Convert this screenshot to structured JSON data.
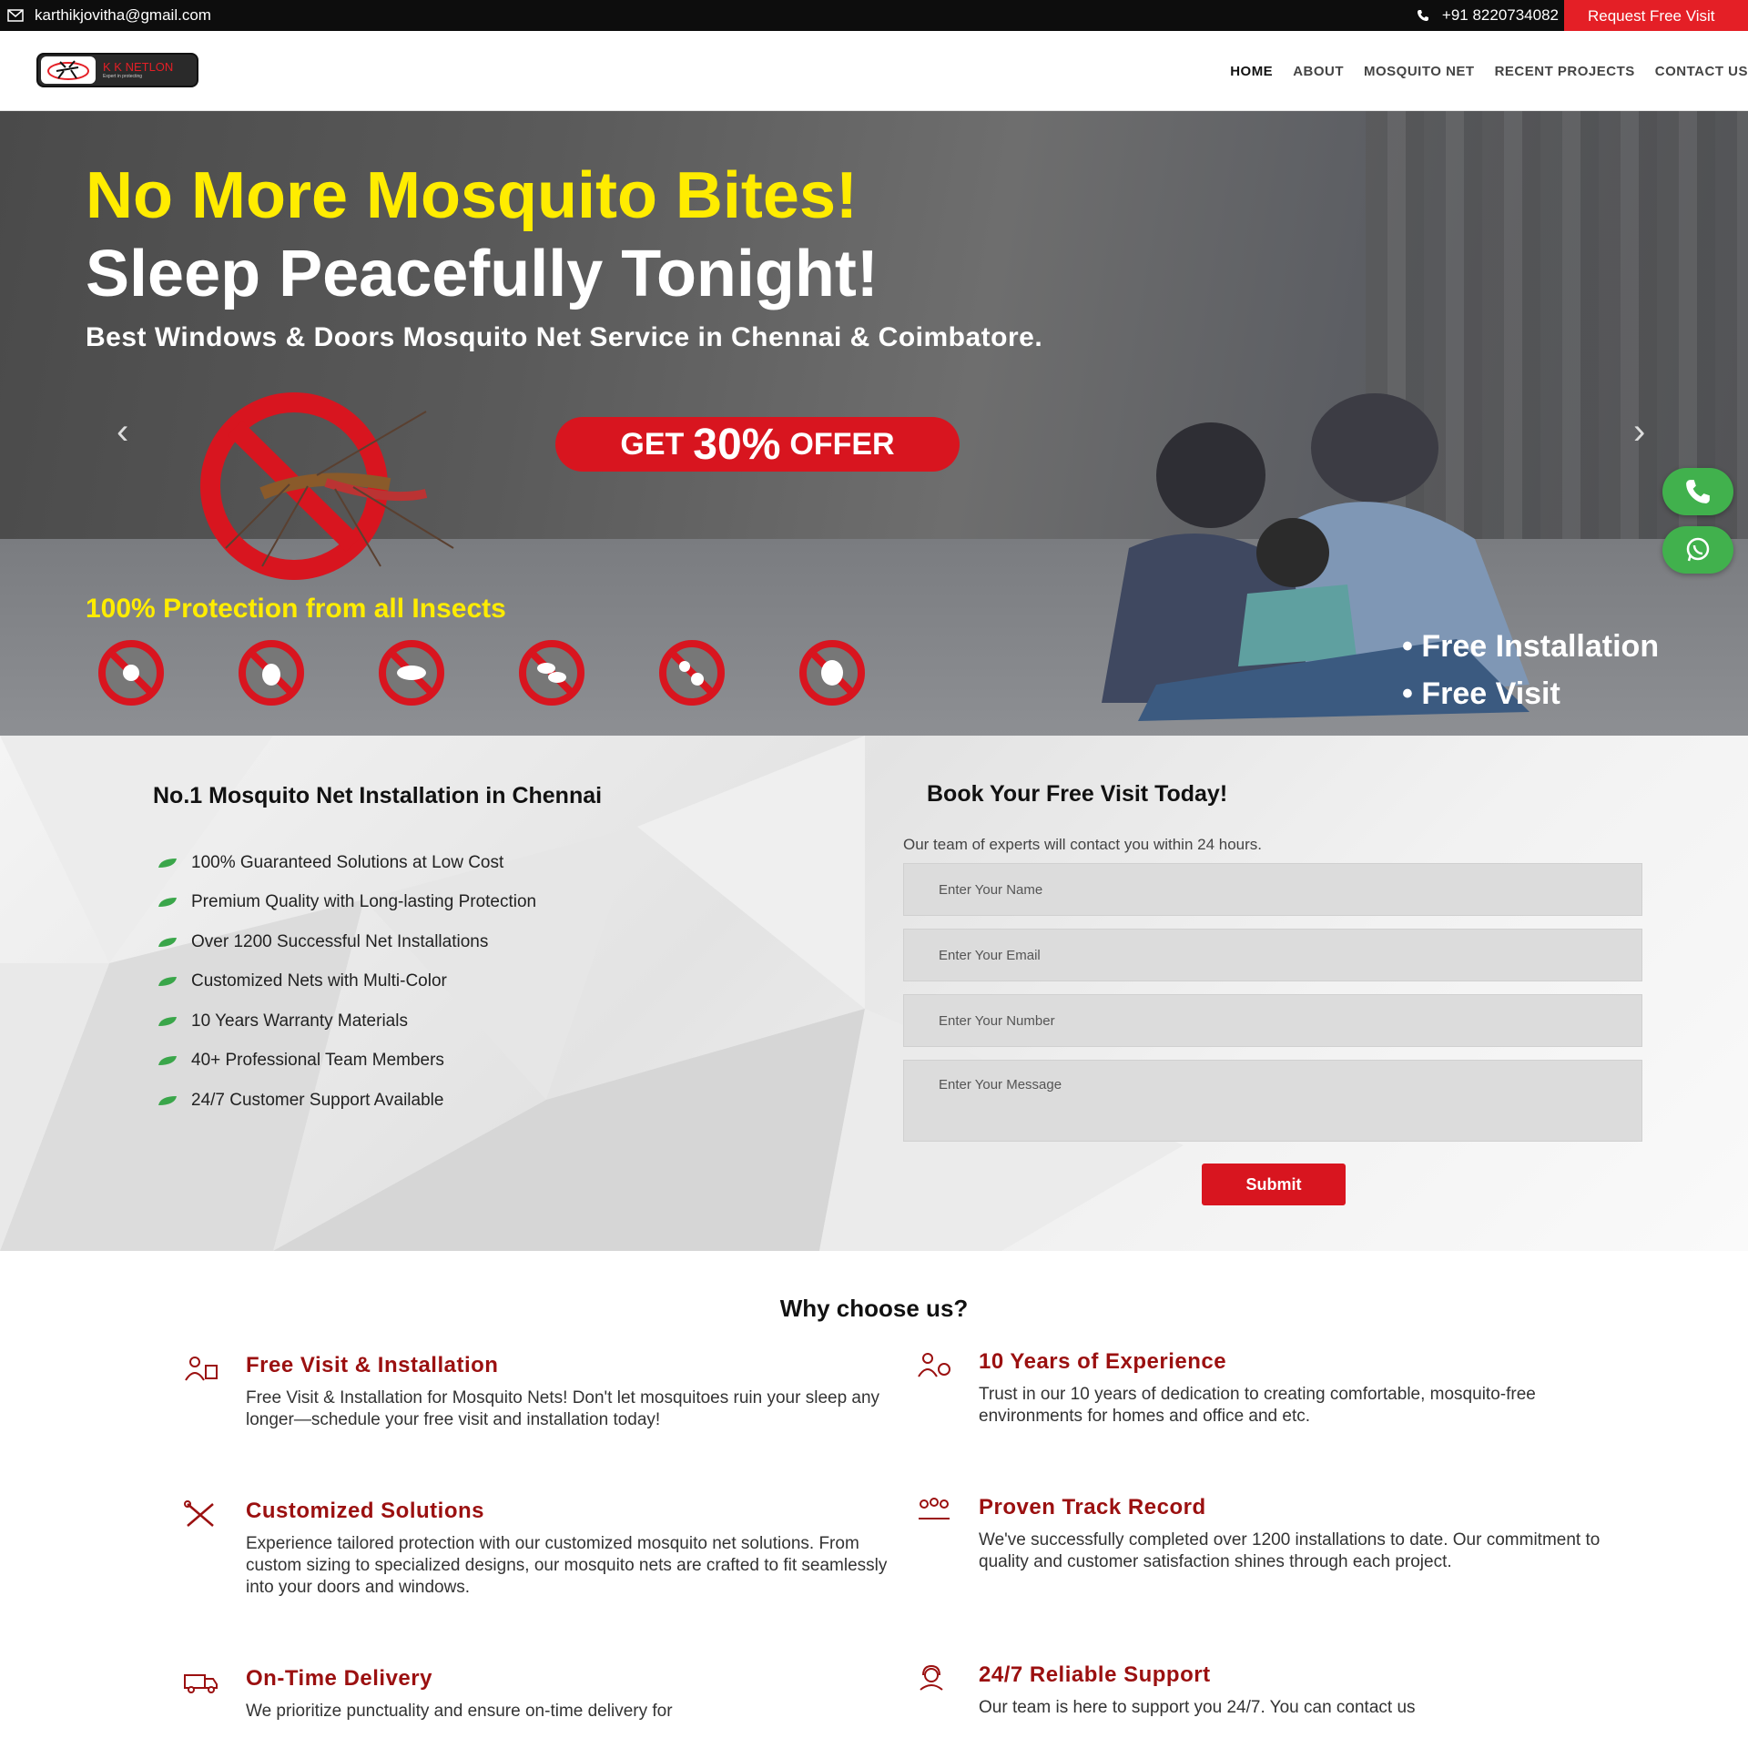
{
  "topbar": {
    "email": "karthikjovitha@gmail.com",
    "phone": "+91 8220734082",
    "cta": "Request Free Visit"
  },
  "brand": {
    "name": "K K NETLON",
    "tagline": "Expert in protecting"
  },
  "nav": {
    "items": [
      "HOME",
      "ABOUT",
      "MOSQUITO NET",
      "RECENT PROJECTS",
      "CONTACT US"
    ],
    "active": "HOME"
  },
  "hero": {
    "headline_1": "No More Mosquito Bites!",
    "headline_2": "Sleep Peacefully Tonight!",
    "subheadline": "Best Windows & Doors Mosquito Net Service in Chennai & Coimbatore.",
    "offer_prefix": "GET",
    "offer_value": "30%",
    "offer_suffix": "OFFER",
    "protection": "100% Protection from all Insects",
    "bullet_1": "Free Installation",
    "bullet_2": "Free Visit",
    "colors": {
      "yellow": "#ffec00",
      "red": "#d8151f",
      "whatsapp": "#41b14d"
    }
  },
  "info": {
    "title": "No.1 Mosquito Net Installation in Chennai",
    "features": [
      "100% Guaranteed Solutions at Low Cost",
      "Premium Quality with Long-lasting Protection",
      "Over 1200 Successful Net Installations",
      "Customized Nets with Multi-Color",
      "10 Years Warranty Materials",
      "40+ Professional Team Members",
      "24/7 Customer Support Available"
    ]
  },
  "form": {
    "title": "Book Your Free Visit Today!",
    "subtitle": "Our team of experts will contact you within 24 hours.",
    "name_placeholder": "Enter Your Name",
    "email_placeholder": "Enter Your Email",
    "number_placeholder": "Enter Your Number",
    "message_placeholder": "Enter Your Message",
    "submit": "Submit"
  },
  "why": {
    "title": "Why choose us?",
    "cards": [
      {
        "title": "Free Visit & Installation",
        "text": "Free Visit & Installation for Mosquito Nets! Don't let mosquitoes ruin your sleep any longer—schedule your free visit and installation today!"
      },
      {
        "title": "10 Years of Experience",
        "text": "Trust in our 10 years of dedication to creating comfortable, mosquito-free environments for homes and office and etc."
      },
      {
        "title": "Customized Solutions",
        "text": "Experience tailored protection with our customized mosquito net solutions. From custom sizing to specialized designs, our mosquito nets are crafted to fit seamlessly into your doors and windows."
      },
      {
        "title": "Proven Track Record",
        "text": "We've successfully completed over 1200 installations to date. Our commitment to quality and customer satisfaction shines through each project."
      },
      {
        "title": "On-Time Delivery",
        "text": "We prioritize punctuality and ensure on-time delivery for"
      },
      {
        "title": "24/7 Reliable Support",
        "text": "Our team is here to support you 24/7. You can contact us"
      }
    ]
  }
}
